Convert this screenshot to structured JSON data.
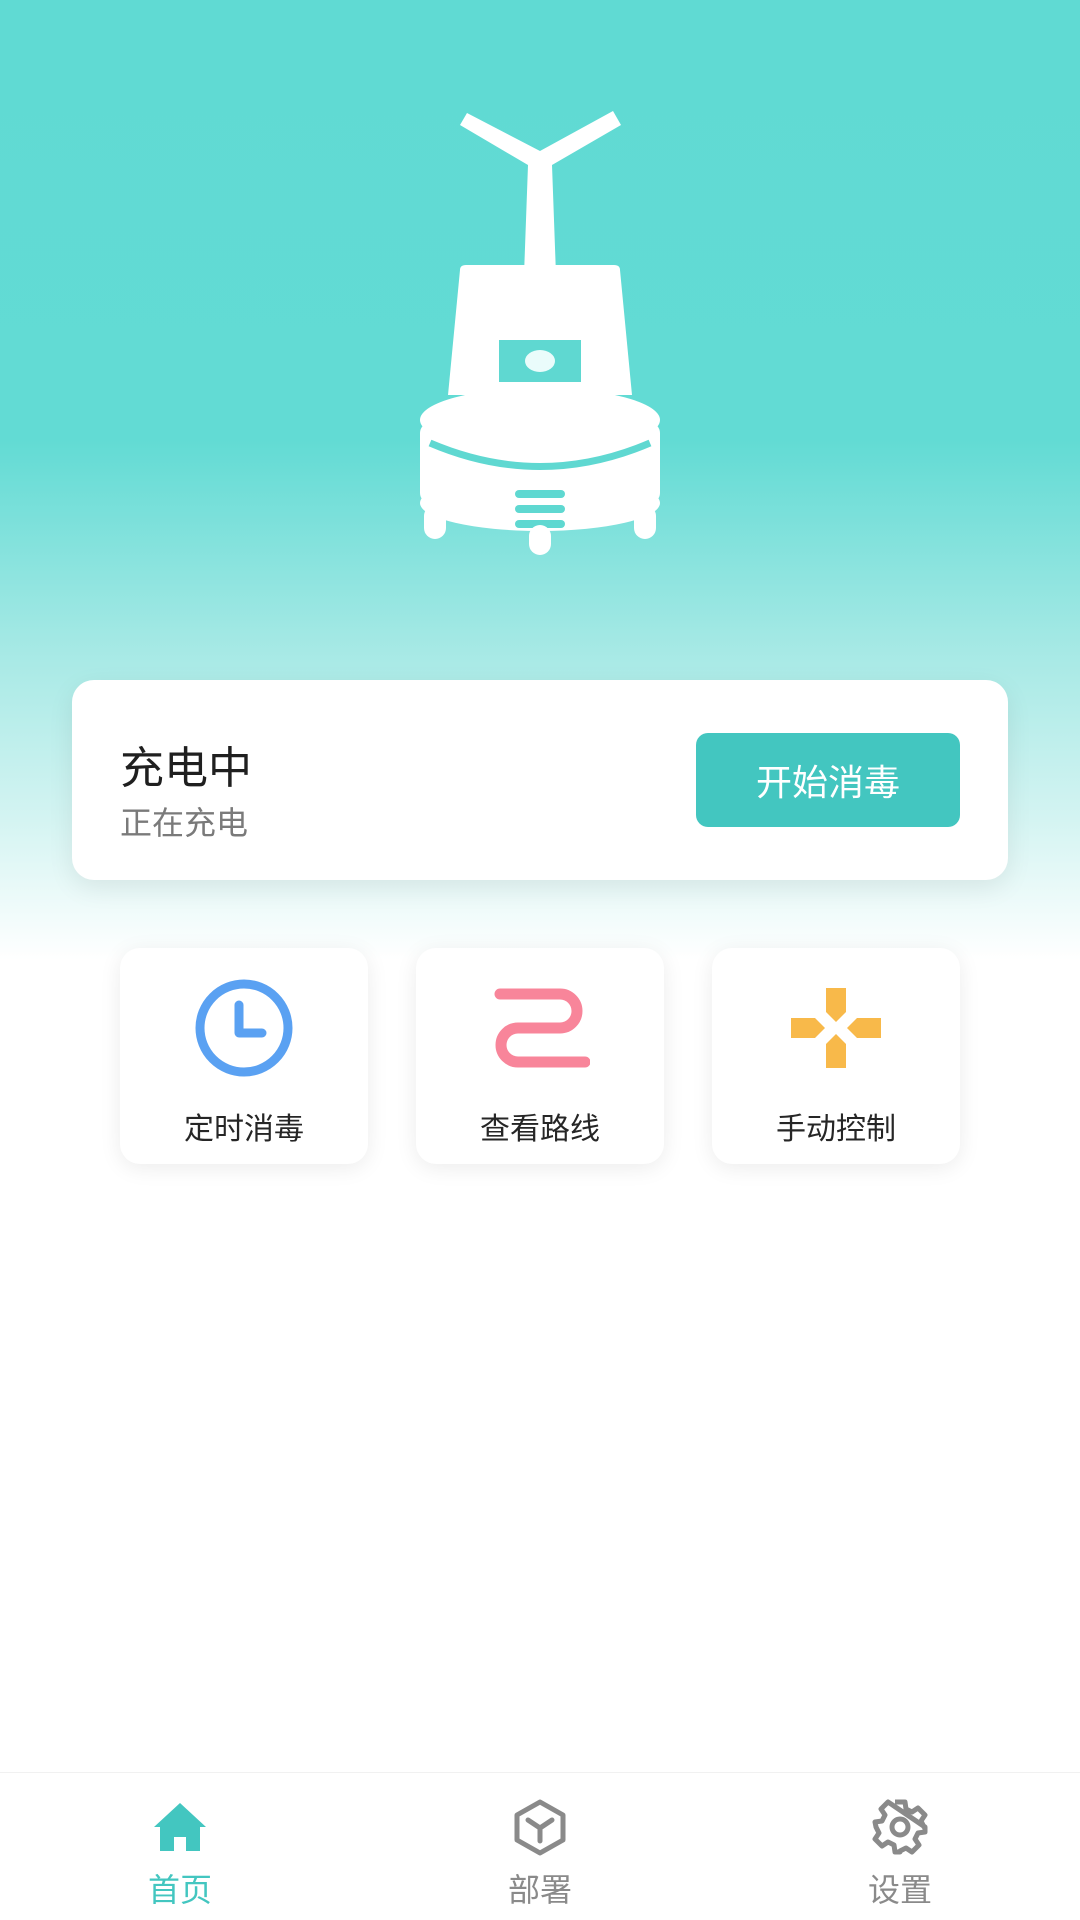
{
  "status_card": {
    "title": "充电中",
    "subtitle": "正在充电",
    "start_button_label": "开始消毒"
  },
  "quick_actions": [
    {
      "label": "定时消毒",
      "icon": "clock-icon",
      "color": "#5aa1f2"
    },
    {
      "label": "查看路线",
      "icon": "route-icon",
      "color": "#f8859a"
    },
    {
      "label": "手动控制",
      "icon": "dpad-icon",
      "color": "#f8b94a"
    }
  ],
  "tabbar": {
    "items": [
      {
        "label": "首页",
        "icon": "home-icon",
        "active": true
      },
      {
        "label": "部署",
        "icon": "cube-icon",
        "active": false
      },
      {
        "label": "设置",
        "icon": "gear-icon",
        "active": false
      }
    ]
  },
  "colors": {
    "brand": "#43c6c0",
    "hero_top": "#60dad3",
    "tab_active": "#43c6c0",
    "tab_inactive": "#8a8a8a"
  }
}
